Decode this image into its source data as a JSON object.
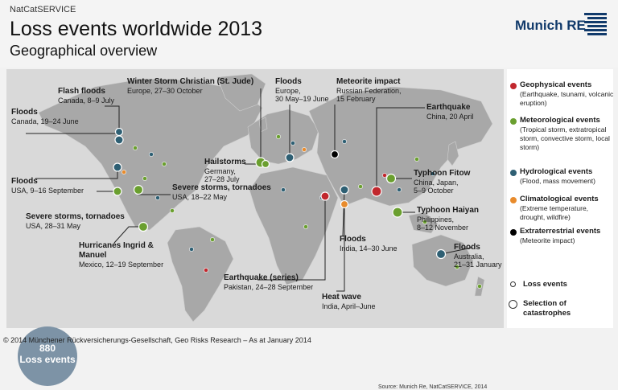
{
  "header": {
    "eyebrow": "NatCatSERVICE",
    "title": "Loss events worldwide 2013",
    "subtitle": "Geographical overview",
    "logo_text": "Munich RE"
  },
  "colors": {
    "geophysical": "#c1272d",
    "meteorological": "#6a9f2f",
    "hydrological": "#2e5f73",
    "climatological": "#e88b2c",
    "extraterrestrial": "#000000",
    "land": "#a8a8a8",
    "ocean": "#d9d9d9",
    "logo": "#113a6b"
  },
  "legend": {
    "categories": [
      {
        "key": "geophysical",
        "title": "Geophysical events",
        "desc": "(Earthquake, tsunami, volcanic eruption)"
      },
      {
        "key": "meteorological",
        "title": "Meteorological events",
        "desc": "(Tropical storm, extratropical storm, convective storm, local storm)"
      },
      {
        "key": "hydrological",
        "title": "Hydrological events",
        "desc": "(Flood, mass movement)"
      },
      {
        "key": "climatological",
        "title": "Climatological events",
        "desc": "(Extreme temperature, drought, wildfire)"
      },
      {
        "key": "extraterrestrial",
        "title": "Extraterrestrial events",
        "desc": "(Meteorite impact)"
      }
    ],
    "loss_events_label": "Loss events",
    "catastrophes_label": "Selection of catastrophes"
  },
  "total": {
    "number": "880",
    "label": "Loss events"
  },
  "annotations": [
    {
      "id": "floods-canada",
      "title": "Floods",
      "lines": [
        "Canada, 19–24 June"
      ]
    },
    {
      "id": "flash-floods-canada",
      "title": "Flash floods",
      "lines": [
        "Canada, 8–9 July"
      ]
    },
    {
      "id": "winter-storm",
      "title": "Winter Storm Christian (St. Jude)",
      "lines": [
        "Europe, 27–30 October"
      ]
    },
    {
      "id": "floods-europe",
      "title": "Floods",
      "lines": [
        "Europe,",
        "30 May–19 June"
      ]
    },
    {
      "id": "meteorite",
      "title": "Meteorite impact",
      "lines": [
        "Russian Federation,",
        "15 February"
      ]
    },
    {
      "id": "earthquake-china",
      "title": "Earthquake",
      "lines": [
        "China, 20 April"
      ]
    },
    {
      "id": "hailstorms",
      "title": "Hailstorms",
      "lines": [
        "Germany,",
        "27–28 July"
      ]
    },
    {
      "id": "floods-usa",
      "title": "Floods",
      "lines": [
        "USA, 9–16 September"
      ]
    },
    {
      "id": "storms-usa-may18",
      "title": "Severe storms, tornadoes",
      "lines": [
        "USA, 18–22 May"
      ]
    },
    {
      "id": "storms-usa-may28",
      "title": "Severe storms, tornadoes",
      "lines": [
        "USA, 28–31 May"
      ]
    },
    {
      "id": "typhoon-fitow",
      "title": "Typhoon Fitow",
      "lines": [
        "China, Japan,",
        "5–9 October"
      ]
    },
    {
      "id": "typhoon-haiyan",
      "title": "Typhoon Haiyan",
      "lines": [
        "Philippines,",
        "8–12 November"
      ]
    },
    {
      "id": "floods-india",
      "title": "Floods",
      "lines": [
        "India, 14–30 June"
      ]
    },
    {
      "id": "floods-australia",
      "title": "Floods",
      "lines": [
        "Australia,",
        "21–31 January"
      ]
    },
    {
      "id": "hurricanes",
      "title": "Hurricanes Ingrid & Manuel",
      "lines": [
        "Mexico, 12–19 September"
      ]
    },
    {
      "id": "earthquake-pakistan",
      "title": "Earthquake (series)",
      "lines": [
        "Pakistan, 24–28 September"
      ]
    },
    {
      "id": "heat-wave",
      "title": "Heat wave",
      "lines": [
        "India, April–June"
      ]
    }
  ],
  "source": "Source: Munich Re, NatCatSERVICE, 2014",
  "footer": "© 2014 Münchener Rückversicherungs-Gesellschaft, Geo Risks Research – As at January 2014"
}
